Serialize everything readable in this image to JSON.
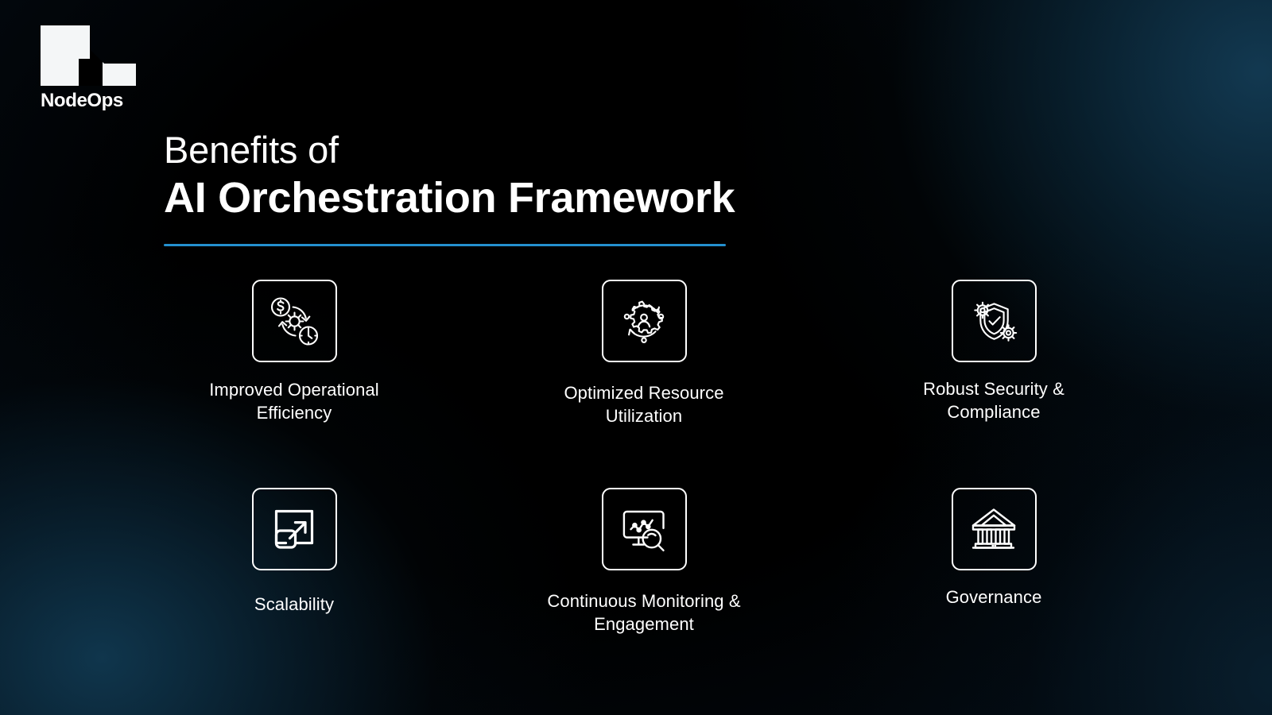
{
  "brand": {
    "name": "NodeOps",
    "logo_icon": "nodeops-n-mark-icon",
    "logo_color": "#ffffff"
  },
  "heading": {
    "line1": "Benefits of",
    "line2": "AI Orchestration Framework",
    "divider_color": "#2490cf"
  },
  "theme": {
    "background_color": "#000000",
    "glow_color": "#123e58",
    "text_color": "#ffffff",
    "accent_color": "#2490cf"
  },
  "benefits": [
    {
      "label": "Improved Operational Efficiency",
      "icon": "coin-gear-clock-cycle-icon"
    },
    {
      "label": "Optimized Resource Utilization",
      "icon": "gear-user-orbit-icon"
    },
    {
      "label": "Robust Security & Compliance",
      "icon": "shield-check-gears-icon"
    },
    {
      "label": "Scalability",
      "icon": "expand-squares-arrow-icon"
    },
    {
      "label": "Continuous Monitoring & Engagement",
      "icon": "monitor-chart-magnifier-icon"
    },
    {
      "label": "Governance",
      "icon": "classical-building-icon"
    }
  ]
}
